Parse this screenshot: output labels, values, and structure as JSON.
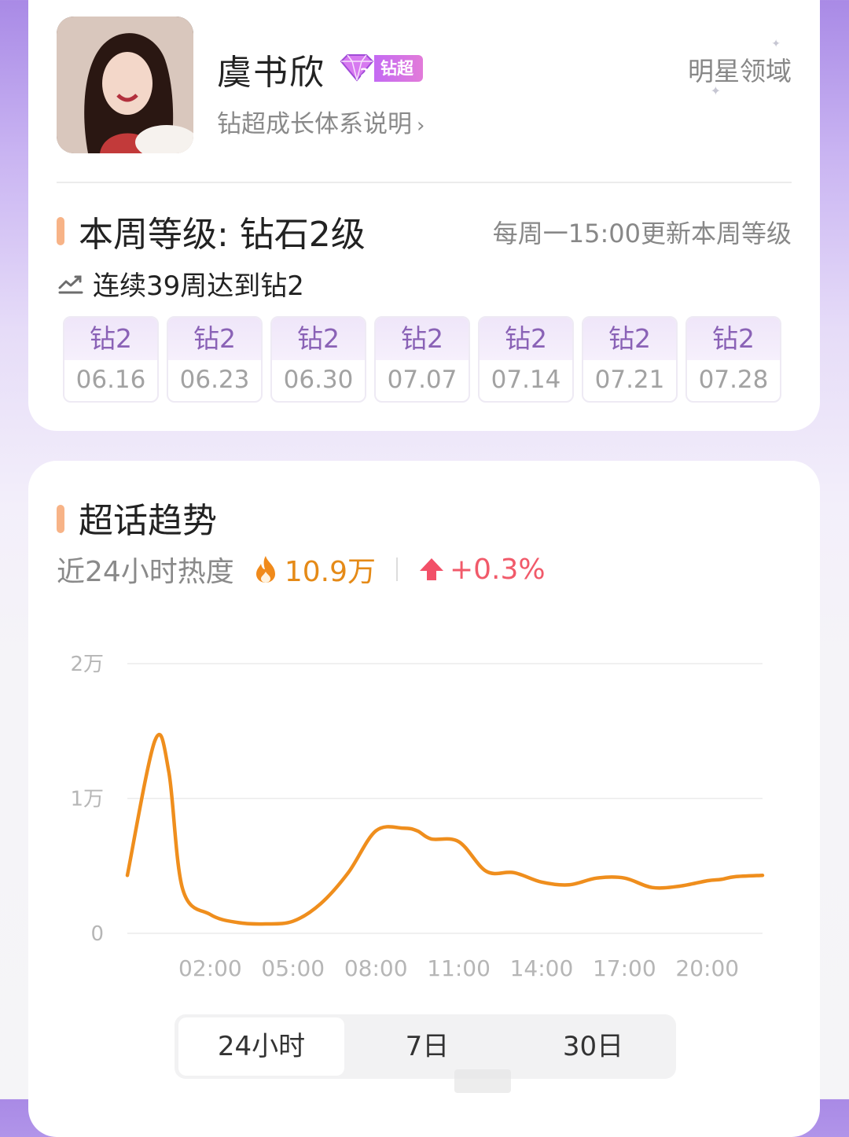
{
  "profile": {
    "name": "虞书欣",
    "badge_label": "钻超",
    "badge_level": "2",
    "growth_link": "钻超成长体系说明",
    "realm": "明星领域"
  },
  "level": {
    "title": "本周等级: 钻石2级",
    "update_note": "每周一15:00更新本周等级",
    "streak": "连续39周达到钻2",
    "weeks": [
      {
        "level": "钻2",
        "date": "06.16"
      },
      {
        "level": "钻2",
        "date": "06.23"
      },
      {
        "level": "钻2",
        "date": "06.30"
      },
      {
        "level": "钻2",
        "date": "07.07"
      },
      {
        "level": "钻2",
        "date": "07.14"
      },
      {
        "level": "钻2",
        "date": "07.21"
      },
      {
        "level": "钻2",
        "date": "07.28"
      }
    ]
  },
  "trend": {
    "title": "超话趋势",
    "heat_label": "近24小时热度",
    "heat_value": "10.9万",
    "heat_change": "+0.3%",
    "tabs": [
      "24小时",
      "7日",
      "30日"
    ],
    "active_tab": "24小时"
  },
  "chart_data": {
    "type": "line",
    "title": "",
    "xlabel": "",
    "ylabel": "",
    "y_tick_labels": [
      "0",
      "1万",
      "2万"
    ],
    "y_ticks": [
      0,
      10000,
      20000
    ],
    "ylim": [
      0,
      20000
    ],
    "xlim": [
      -1,
      22
    ],
    "x_tick_labels": [
      "02:00",
      "05:00",
      "08:00",
      "11:00",
      "14:00",
      "17:00",
      "20:00"
    ],
    "x_ticks": [
      2,
      5,
      8,
      11,
      14,
      17,
      20
    ],
    "grid": true,
    "line_color": "#ef8e1d",
    "series": [
      {
        "x": [
          -1,
          0,
          0.5,
          1,
          2,
          3,
          4,
          5,
          6,
          7,
          8,
          9,
          9.5,
          10,
          11,
          12,
          13,
          14,
          15,
          16,
          17,
          18,
          19,
          20,
          20.5,
          21,
          22
        ],
        "values": [
          4300,
          14300,
          12000,
          3300,
          1400,
          800,
          700,
          900,
          2200,
          4500,
          7600,
          7800,
          7600,
          7000,
          6800,
          4600,
          4500,
          3800,
          3600,
          4100,
          4100,
          3400,
          3500,
          3900,
          4000,
          4200,
          4300
        ]
      }
    ]
  }
}
